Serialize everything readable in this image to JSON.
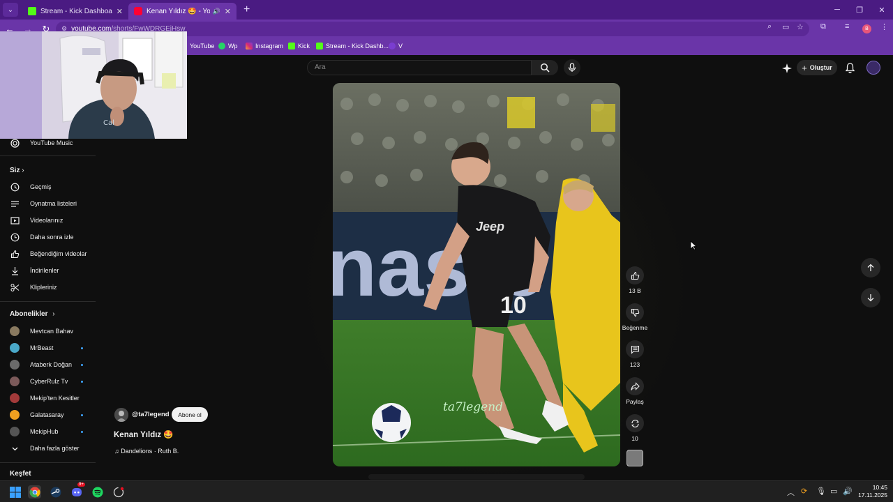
{
  "browser": {
    "tabs": [
      {
        "title": "Stream - Kick Dashboard",
        "close": "✕"
      },
      {
        "title": "Kenan Yıldız 🤩 - YouTube",
        "close": "✕"
      }
    ],
    "new_tab": "+",
    "url_host": "youtube.com",
    "url_path": "/shorts/FwWDRGEjHsw",
    "profile_initial": "B",
    "bookmarks": [
      "YouTube",
      "Wp",
      "Instagram",
      "Kick",
      "Stream - Kick Dashb...",
      "V"
    ]
  },
  "youtube": {
    "search_placeholder": "Ara",
    "create_label": "Oluştur"
  },
  "sidebar": {
    "youtube_music": "YouTube Music",
    "you_heading": "Siz",
    "you_items": [
      "Geçmiş",
      "Oynatma listeleri",
      "Videolarınız",
      "Daha sonra izle",
      "Beğendiğim videolar",
      "İndirilenler",
      "Klipleriniz"
    ],
    "subs_heading": "Abonelikler",
    "subscriptions": [
      {
        "name": "Mevtcan Bahav",
        "color": "#8a7a60",
        "new": false
      },
      {
        "name": "MrBeast",
        "color": "#4aa8c8",
        "new": true
      },
      {
        "name": "Ataberk Doğan",
        "color": "#6b6b6b",
        "new": true
      },
      {
        "name": "CyberRulz Tv",
        "color": "#7c5a5a",
        "new": true
      },
      {
        "name": "Mekip'ten Kesitler",
        "color": "#a33a3a",
        "new": false
      },
      {
        "name": "Galatasaray",
        "color": "#f0a020",
        "new": true
      },
      {
        "name": "MekipHub",
        "color": "#555555",
        "new": true
      }
    ],
    "show_more": "Daha fazla göster",
    "explore_heading": "Keşfet"
  },
  "short": {
    "channel_handle": "@ta7legend",
    "subscribe_label": "Abone ol",
    "title": "Kenan Yıldız 🤩",
    "music": "♫ Dandelions · Ruth B.",
    "watermark": "ta7legend",
    "jersey_number": "10",
    "likes": "13 B",
    "dislike_label": "Beğenme",
    "comments": "123",
    "share_label": "Paylaş",
    "remix_count": "10"
  },
  "taskbar": {
    "time": "10:45",
    "date": "17.11.2025",
    "discord_badge": "9+"
  },
  "colors": {
    "chrome_tabbar": "#4a1b82",
    "chrome_toolbar": "#6a35a8",
    "yt_background": "#0f0f0f",
    "kick_green": "#53fc18",
    "yt_red": "#ff0033"
  }
}
